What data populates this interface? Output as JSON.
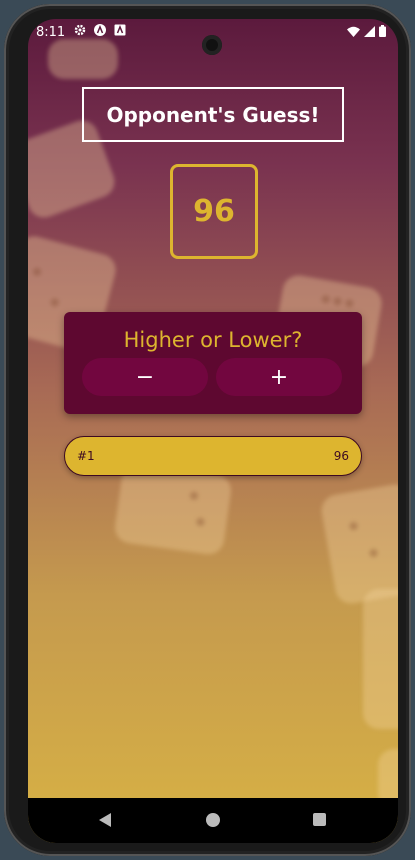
{
  "status_bar": {
    "time": "8:11",
    "icons": [
      "gear-icon",
      "a-icon",
      "a-box-icon"
    ],
    "right_icons": [
      "wifi-icon",
      "signal-icon",
      "battery-icon"
    ]
  },
  "game": {
    "title": "Opponent's Guess!",
    "current_guess": "96",
    "prompt": "Higher or Lower?",
    "lower_label": "−",
    "higher_label": "+"
  },
  "guess_log": [
    {
      "round": "#1",
      "guess": "96"
    }
  ],
  "colors": {
    "accent": "#ddb52f",
    "card": "#5e0830",
    "button": "#72063f",
    "bg_top": "#5c1a3d",
    "bg_bottom": "#d8b244"
  }
}
